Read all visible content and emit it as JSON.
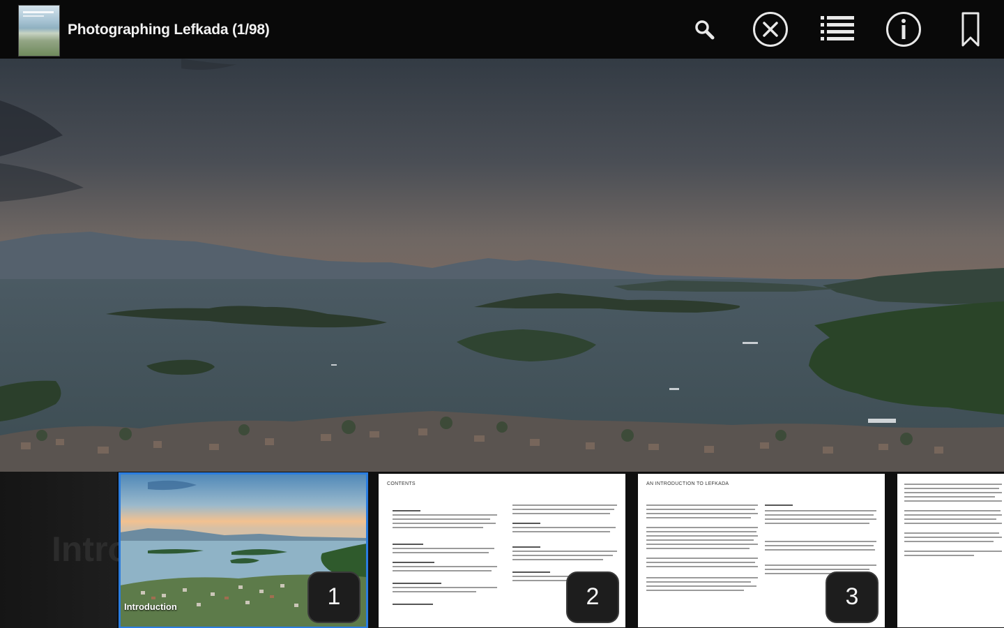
{
  "header": {
    "title": "Photographing Lefkada (1/98)",
    "actions": [
      {
        "name": "search",
        "icon": "search-icon"
      },
      {
        "name": "close",
        "icon": "close-circle-icon"
      },
      {
        "name": "table-of-contents",
        "icon": "list-icon"
      },
      {
        "name": "info",
        "icon": "info-icon"
      },
      {
        "name": "bookmark",
        "icon": "bookmark-icon"
      }
    ]
  },
  "strip": {
    "ghost_text": "Intro",
    "thumbnails": [
      {
        "page": "1",
        "caption": "Introduction",
        "heading": "",
        "selected": true
      },
      {
        "page": "2",
        "caption": "",
        "heading": "CONTENTS",
        "selected": false
      },
      {
        "page": "3",
        "caption": "",
        "heading": "AN INTRODUCTION TO LEFKADA",
        "selected": false
      },
      {
        "page": "",
        "caption": "",
        "heading": "",
        "selected": false
      }
    ]
  },
  "colors": {
    "topbar": "#090909",
    "selection_outline": "#2b7de0",
    "badge_bg": "#1d1d1d",
    "text": "#f2f2f2"
  }
}
